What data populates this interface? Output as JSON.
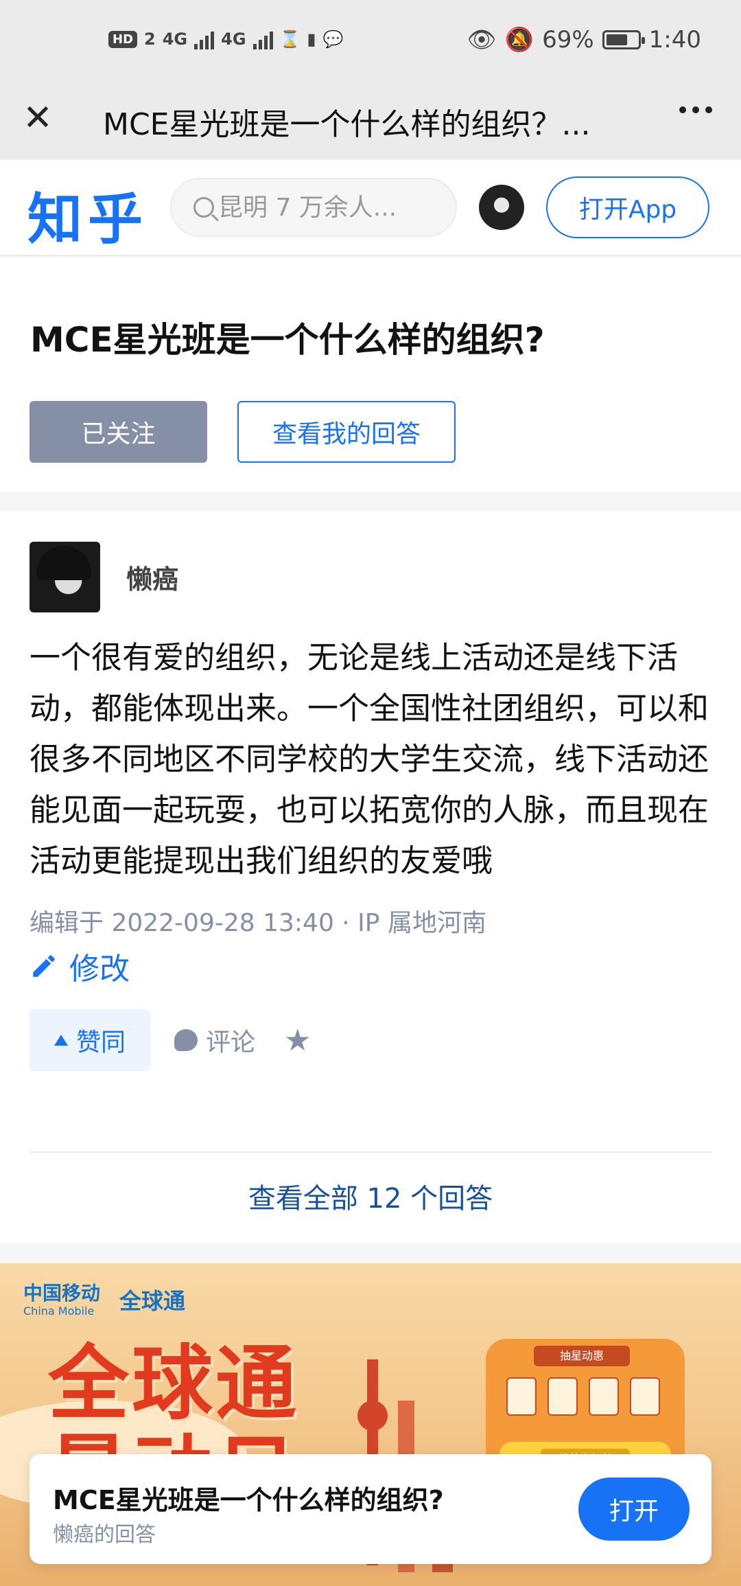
{
  "status_bar": {
    "hd_badge": "HD",
    "sim_slot": "2",
    "network_1": "4G",
    "network_2": "4G",
    "battery_percent": "69%",
    "time": "1:40"
  },
  "title_bar": {
    "title": "MCE星光班是一个什么样的组织？..."
  },
  "header": {
    "logo": "知乎",
    "search_placeholder": "昆明 7 万余人...",
    "open_app_label": "打开App"
  },
  "question": {
    "title": "MCE星光班是一个什么样的组织?",
    "followed_label": "已关注",
    "view_my_answer_label": "查看我的回答"
  },
  "answer": {
    "author": "懒癌",
    "content": "一个很有爱的组织，无论是线上活动还是线下活动，都能体现出来。一个全国性社团组织，可以和很多不同地区不同学校的大学生交流，线下活动还能见面一起玩耍，也可以拓宽你的人脉，而且现在活动更能提现出我们组织的友爱哦",
    "meta": "编辑于 2022-09-28 13:40 · IP 属地河南",
    "edit_label": "修改",
    "vote_label": "赞同",
    "comment_label": "评论",
    "view_all_label": "查看全部 12 个回答"
  },
  "banner": {
    "brand_1": "中国移动",
    "brand_1_en": "China Mobile",
    "brand_2": "全球通",
    "headline_1": "全球通",
    "headline_2": "最动日",
    "tag_1": "抽星动惠",
    "tag_2": "领尊享权益"
  },
  "float_card": {
    "title": "MCE星光班是一个什么样的组织?",
    "subtitle": "懒癌的回答",
    "open_label": "打开"
  },
  "colors": {
    "zhihu_blue": "#1772f6",
    "gray_button": "#8590a6"
  }
}
